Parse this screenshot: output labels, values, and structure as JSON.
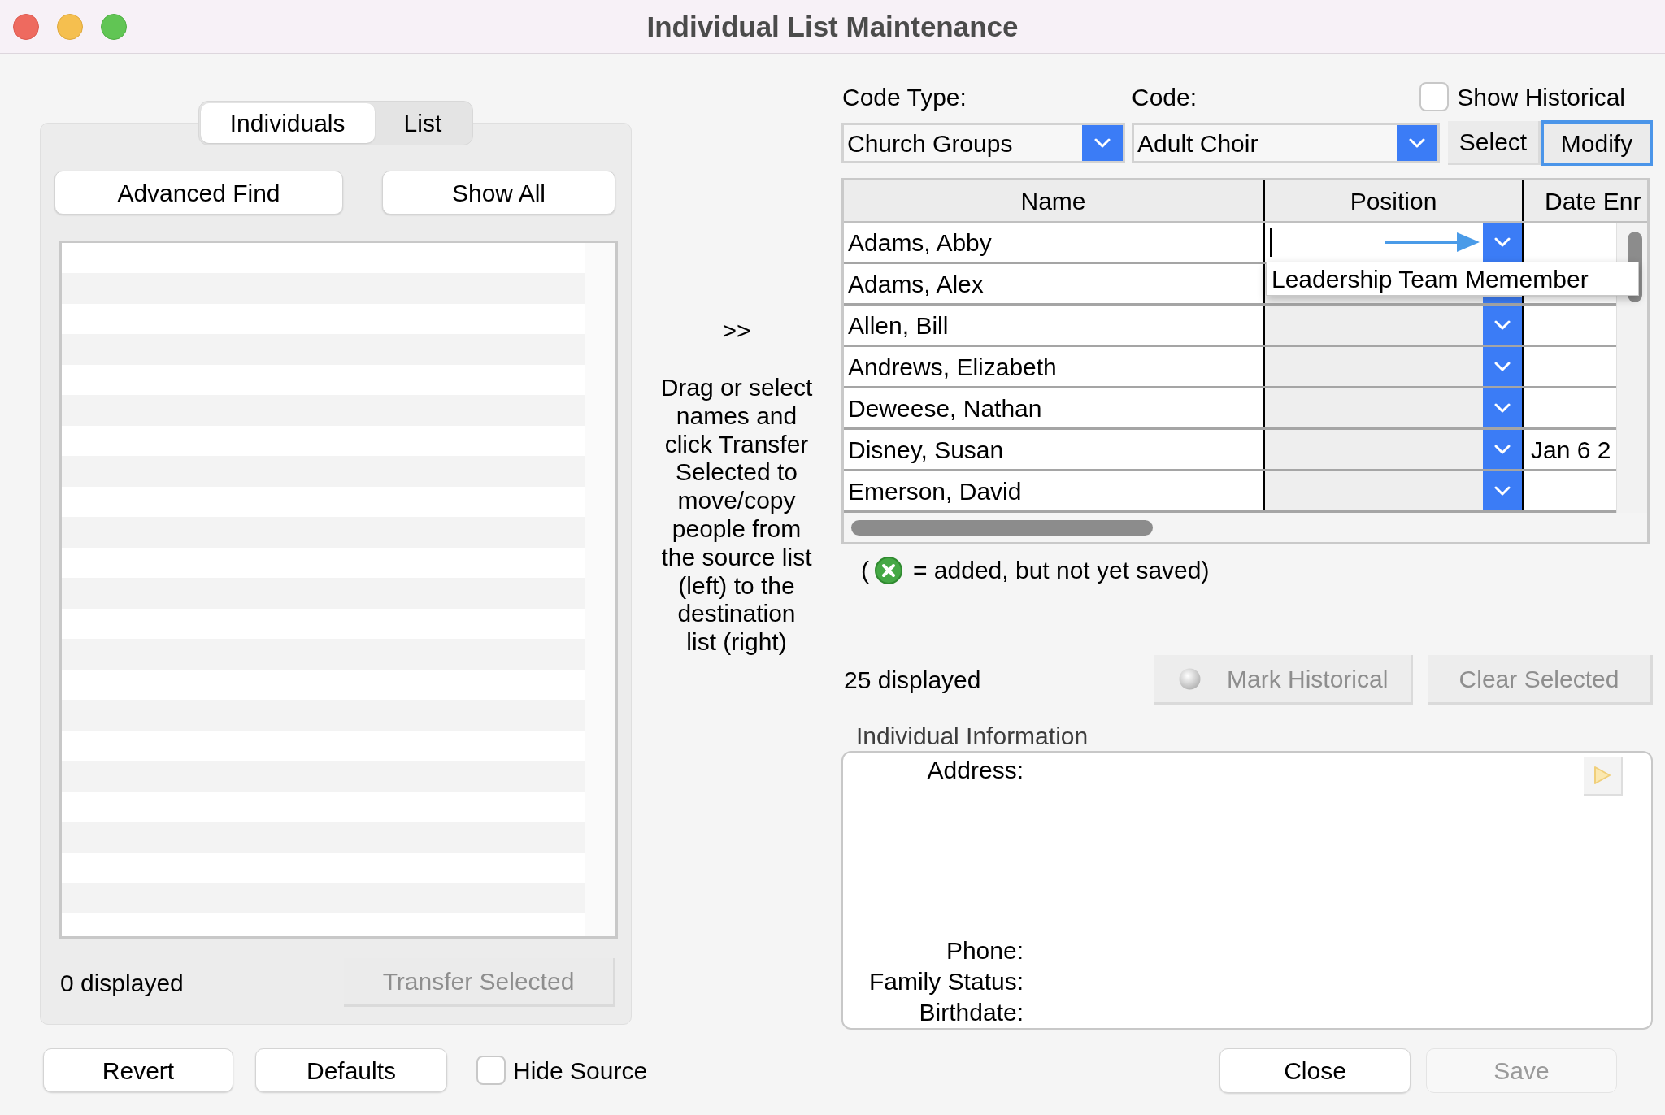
{
  "window": {
    "title": "Individual List Maintenance"
  },
  "source_panel": {
    "tabs": [
      {
        "label": "Individuals",
        "selected": true
      },
      {
        "label": "List",
        "selected": false
      }
    ],
    "buttons": [
      {
        "label": "Advanced Find",
        "disabled": false
      },
      {
        "label": "Show All",
        "disabled": false
      }
    ],
    "count": "0 displayed",
    "transfer_button": {
      "label": "Transfer Selected",
      "disabled": true
    }
  },
  "footer_left": {
    "buttons": [
      {
        "label": "Revert",
        "disabled": false
      },
      {
        "label": "Defaults",
        "disabled": false
      }
    ],
    "hide_source": {
      "label": "Hide Source",
      "checked": false
    }
  },
  "transfer": {
    "arrow": ">>",
    "instructions": "Drag or select\nnames and\nclick Transfer\nSelected to\nmove/copy\npeople from\nthe source list\n(left) to the\ndestination\nlist (right)"
  },
  "code_selector": {
    "code_type_label": "Code Type:",
    "code_type_value": "Church Groups",
    "code_label": "Code:",
    "code_value": "Adult Choir",
    "show_historical": {
      "label": "Show Historical",
      "checked": false
    },
    "buttons": [
      {
        "label": "Select",
        "focused": false
      },
      {
        "label": "Modify",
        "focused": true
      }
    ]
  },
  "table": {
    "columns": [
      "Name",
      "Position",
      "Date Enr"
    ],
    "rows": [
      {
        "name": "Adams, Abby",
        "editing": true,
        "dropdown_options": [
          "Leadership Team Memember"
        ]
      },
      {
        "name": "Adams, Alex",
        "editing": false
      },
      {
        "name": "Allen, Bill",
        "editing": false
      },
      {
        "name": "Andrews, Elizabeth",
        "editing": false
      },
      {
        "name": "Deweese, Nathan",
        "editing": false
      },
      {
        "name": "Disney, Susan",
        "editing": false,
        "date": "Jan 6 2"
      },
      {
        "name": "Emerson, David",
        "editing": false
      }
    ]
  },
  "legend": {
    "open": "(",
    "text": "= added, but not yet saved)"
  },
  "members_count": "25 displayed",
  "action_buttons": [
    {
      "label": "Mark Historical",
      "disabled": true
    },
    {
      "label": "Clear Selected",
      "disabled": true
    }
  ],
  "individual_info": {
    "title": "Individual Information",
    "address_label": "Address:",
    "field_labels": [
      "Phone:",
      "Family Status:",
      "Birthdate:"
    ],
    "play_button": {
      "disabled": true
    }
  },
  "dialog_buttons": [
    {
      "label": "Close",
      "disabled": false
    },
    {
      "label": "Save",
      "disabled": true
    }
  ]
}
